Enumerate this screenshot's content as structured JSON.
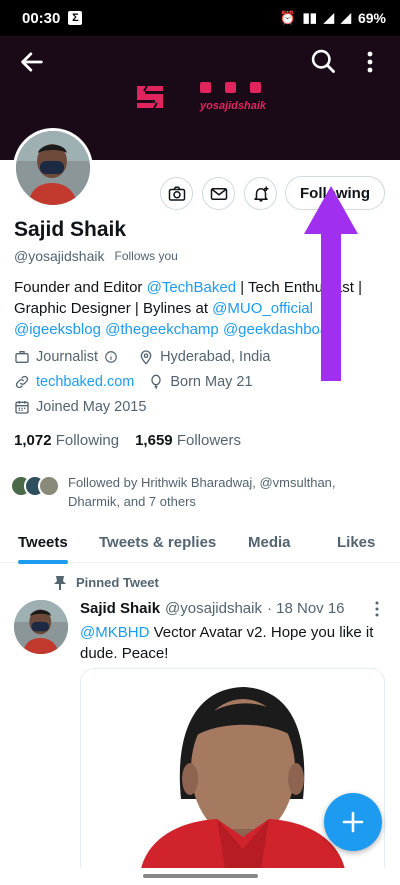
{
  "status_bar": {
    "time": "00:30",
    "battery": "69%"
  },
  "banner": {
    "handle_text": "yosajidshaik"
  },
  "profile": {
    "name": "Sajid Shaik",
    "handle": "@yosajidshaik",
    "follows_you": "Follows you",
    "following_button": "Following",
    "bio": {
      "part1": "Founder and Editor ",
      "mention1": "@TechBaked",
      "part2": " | Tech Enthusiast | Graphic Designer | Bylines at ",
      "mention2": "@MUO_official",
      "mention3": "@igeeksblog",
      "mention4": "@thegeekchamp",
      "mention5": "@geekdashboard"
    },
    "occupation": "Journalist",
    "location": "Hyderabad, India",
    "website": "techbaked.com",
    "birthday": "Born May 21",
    "joined": "Joined May 2015",
    "following_count": "1,072",
    "following_label": "Following",
    "followers_count": "1,659",
    "followers_label": "Followers",
    "followed_by": "Followed by Hrithwik Bharadwaj, @vmsulthan, Dharmik, and 7 others"
  },
  "tabs": [
    "Tweets",
    "Tweets & replies",
    "Media",
    "Likes"
  ],
  "pinned_tweet": {
    "pinned_label": "Pinned Tweet",
    "author_name": "Sajid Shaik",
    "author_handle": "@yosajidshaik",
    "date": "· 18 Nov 16",
    "mention": "@MKBHD",
    "text": " Vector Avatar v2. Hope you like it dude. Peace!"
  },
  "icons": {
    "back": "arrow-left-icon",
    "search": "search-icon",
    "more": "more-vertical-icon",
    "fab": "plus-icon"
  },
  "colors": {
    "accent": "#1d9bf0",
    "banner_bg": "#1a0a17",
    "annotation_arrow": "#a12ff0"
  }
}
